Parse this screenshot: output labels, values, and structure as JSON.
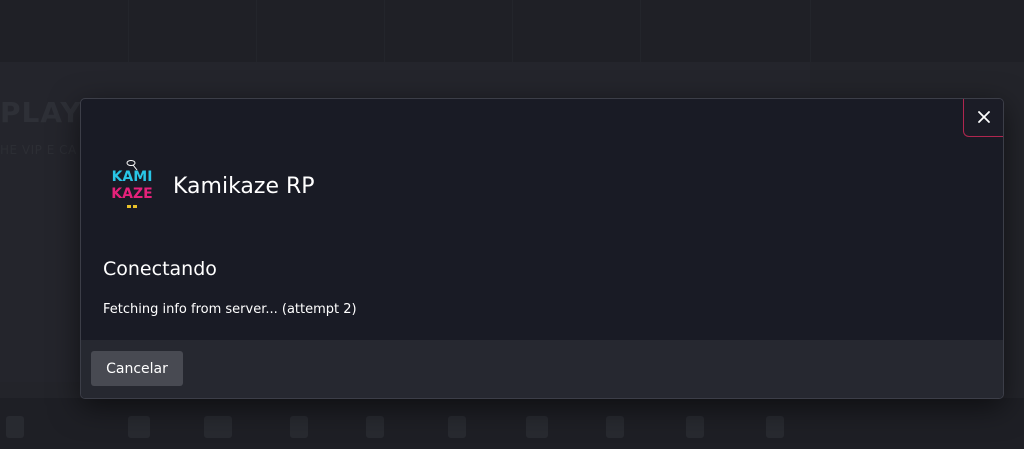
{
  "background": {
    "heading": "PLAY IN",
    "subheading": "HE VIP E CA"
  },
  "modal": {
    "close_icon": "close-icon",
    "server": {
      "logo_icon": "kamikaze-logo",
      "logo_text_top": "KAMI",
      "logo_text_bottom": "KAZE",
      "name": "Kamikaze RP"
    },
    "status_title": "Conectando",
    "status_detail": "Fetching info from server... (attempt 2)",
    "cancel_label": "Cancelar"
  },
  "colors": {
    "modal_bg": "#191b25",
    "footer_bg": "#262830",
    "close_border": "#b0264f",
    "logo_cyan": "#29c5e6",
    "logo_pink": "#e5217a",
    "cancel_bg": "#484a52"
  }
}
